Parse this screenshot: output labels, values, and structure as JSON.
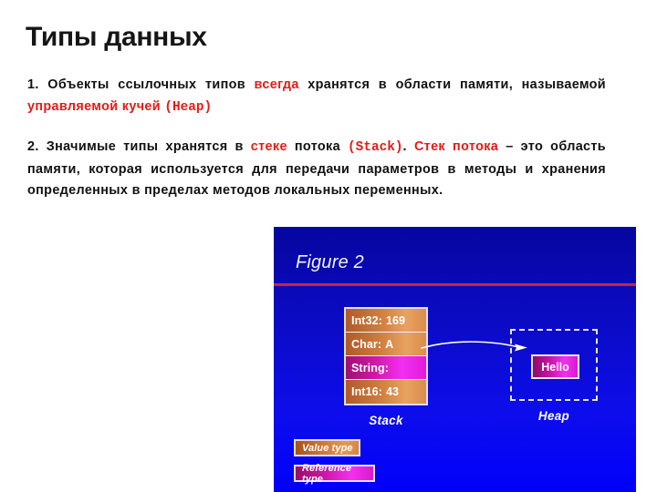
{
  "slide": {
    "title": "Типы данных"
  },
  "body": {
    "paragraph1": {
      "seg1": "1. Объекты ссылочных типов ",
      "hl1": "всегда",
      "seg2": " хранятся в области памяти, называемой ",
      "hl2": "управляемой кучей",
      "seg3": " ",
      "hl3": "(Heap)"
    },
    "paragraph2": {
      "seg1": "2. Значимые типы хранятся в ",
      "hl1": "стеке",
      "seg2": " потока ",
      "hl2": "(Stack)",
      "seg3": ". ",
      "hl3": "Стек потока",
      "seg4": " – это область памяти, которая используется для передачи параметров в методы и хранения определенных в пределах методов локальных переменных."
    }
  },
  "figure": {
    "caption": "Figure 2",
    "stack": {
      "label": "Stack",
      "rows": [
        {
          "type": "Int32",
          "sep": ":",
          "value": "169",
          "kind": "value-type"
        },
        {
          "type": "Char",
          "sep": ":",
          "value": "A",
          "kind": "value-type"
        },
        {
          "type": "String",
          "sep": ":",
          "value": "",
          "kind": "ref-type"
        },
        {
          "type": "Int16",
          "sep": ":",
          "value": "43",
          "kind": "value-type"
        }
      ]
    },
    "heap": {
      "label": "Heap",
      "object_label": "Hello"
    },
    "legend": [
      {
        "label": "Value type",
        "kind": "value-type"
      },
      {
        "label": "Reference type",
        "kind": "ref-type"
      }
    ],
    "colors": {
      "panel_top": "#06069f",
      "panel_bottom": "#0000fb",
      "rule": "#d62a55",
      "value_type": "#d1803f",
      "reference_type": "#e41ad9",
      "arrow": "#ffffff",
      "highlight_text": "#e41b17"
    }
  }
}
